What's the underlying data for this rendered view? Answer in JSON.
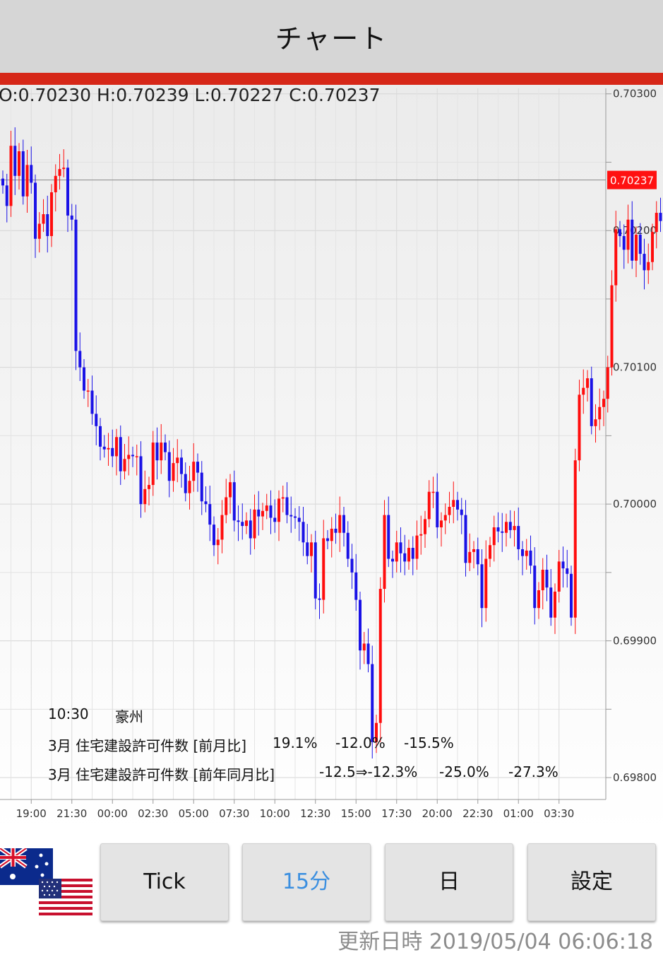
{
  "header": {
    "title": "チャート"
  },
  "ohlc": {
    "text": "O:0.70230 H:0.70239 L:0.70227 C:0.70237"
  },
  "chart_data": {
    "type": "candlestick",
    "y_ticks": [
      "0.70300",
      "0.70200",
      "0.70100",
      "0.70000",
      "0.69900",
      "0.69800"
    ],
    "ylim": [
      0.69784,
      0.70304
    ],
    "x_ticks": [
      "19:00",
      "21:30",
      "00:00",
      "02:30",
      "05:00",
      "07:30",
      "10:00",
      "12:30",
      "15:00",
      "17:30",
      "20:00",
      "22:30",
      "01:00",
      "03:30"
    ],
    "current_price": "0.70237",
    "colors": {
      "up": "#ff0d0d",
      "down": "#1a12e6"
    },
    "closes": [
      0.70233,
      0.70218,
      0.70262,
      0.7024,
      0.70258,
      0.70225,
      0.70248,
      0.70235,
      0.70194,
      0.70205,
      0.70212,
      0.70196,
      0.70228,
      0.7024,
      0.70245,
      0.70246,
      0.70211,
      0.70208,
      0.70112,
      0.701,
      0.70083,
      0.70083,
      0.70066,
      0.70057,
      0.70042,
      0.7004,
      0.70041,
      0.70035,
      0.70049,
      0.70024,
      0.70033,
      0.70036,
      0.70035,
      0.70035,
      0.7,
      0.70011,
      0.70014,
      0.70045,
      0.70032,
      0.70045,
      0.70038,
      0.70017,
      0.7003,
      0.70034,
      0.70022,
      0.70008,
      0.70017,
      0.70031,
      0.70023,
      0.70002,
      0.7,
      0.69985,
      0.6997,
      0.69974,
      0.69992,
      0.70005,
      0.70016,
      0.69988,
      0.69987,
      0.69984,
      0.69988,
      0.69975,
      0.69996,
      0.69991,
      0.69995,
      0.69999,
      0.6999,
      0.69987,
      0.70004,
      0.70005,
      0.69992,
      0.69991,
      0.6999,
      0.69987,
      0.69972,
      0.69962,
      0.69972,
      0.69931,
      0.6993,
      0.69975,
      0.69973,
      0.69982,
      0.69979,
      0.69992,
      0.69979,
      0.6996,
      0.6995,
      0.6993,
      0.69893,
      0.69898,
      0.69883,
      0.69826,
      0.6984,
      0.69938,
      0.69992,
      0.6996,
      0.69958,
      0.69972,
      0.69964,
      0.69958,
      0.69968,
      0.6996,
      0.69977,
      0.69978,
      0.69989,
      0.70009,
      0.70009,
      0.69983,
      0.69988,
      0.69992,
      0.69998,
      0.70003,
      0.69996,
      0.69992,
      0.69957,
      0.69965,
      0.69967,
      0.69956,
      0.69924,
      0.6996,
      0.6997,
      0.69983,
      0.6998,
      0.69979,
      0.69987,
      0.69981,
      0.69984,
      0.69967,
      0.69962,
      0.69966,
      0.69955,
      0.69924,
      0.69937,
      0.69952,
      0.69939,
      0.69917,
      0.69936,
      0.69958,
      0.69953,
      0.69949,
      0.69917,
      0.70032,
      0.7008,
      0.70085,
      0.70092,
      0.70057,
      0.70062,
      0.70071,
      0.70077,
      0.701,
      0.7016,
      0.70201,
      0.70196,
      0.70186,
      0.70208,
      0.70178,
      0.70197,
      0.70183,
      0.70171,
      0.70177,
      0.70199,
      0.70213,
      0.70207,
      0.70201,
      0.70205,
      0.70203,
      0.70195,
      0.70184,
      0.70184,
      0.70186,
      0.70165,
      0.70182,
      0.70156,
      0.70183,
      0.70185,
      0.70193,
      0.7021,
      0.70224,
      0.70244,
      0.70233,
      0.70237
    ],
    "candles_per_tick": 10
  },
  "events": {
    "time": "10:30",
    "country": "豪州",
    "rows": [
      {
        "name": "3月 住宅建設許可件数 [前月比]",
        "actual": "19.1%",
        "forecast": "-12.0%",
        "previous": "-15.5%"
      },
      {
        "name": "3月 住宅建設許可件数 [前年同月比]",
        "actual": "-12.5⇒-12.3%",
        "forecast": "-25.0%",
        "previous": "-27.3%"
      }
    ]
  },
  "buttons": {
    "tick": "Tick",
    "m15": "15分",
    "day": "日",
    "settings": "設定"
  },
  "flags": {
    "base": "AUD",
    "quote": "USD"
  },
  "updated": "更新日時 2019/05/04 06:06:18"
}
